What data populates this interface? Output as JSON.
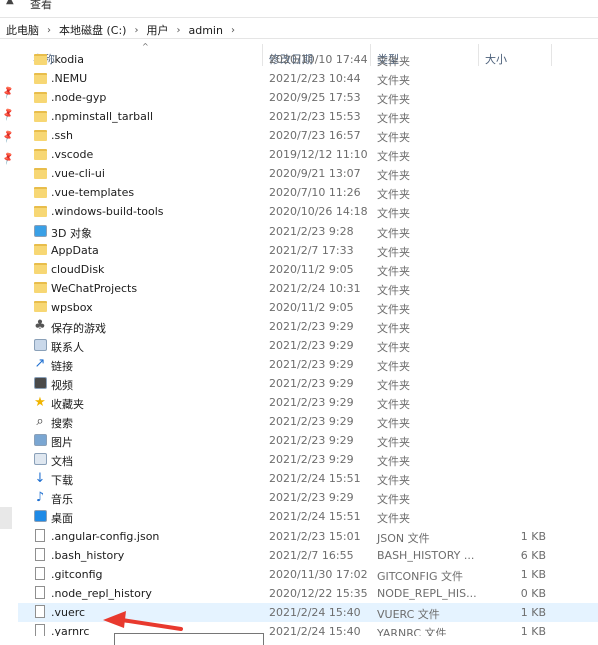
{
  "ribbon": {
    "view_tab": "查看"
  },
  "address": {
    "crumbs": [
      "此电脑",
      "本地磁盘 (C:)",
      "用户",
      "admin"
    ]
  },
  "columns": {
    "name": "名称",
    "date": "修改日期",
    "type": "类型",
    "size": "大小"
  },
  "colors": {
    "folder": "#f7d774",
    "selected_row": "#e5f3ff",
    "arrow": "#e8392e",
    "header_text": "#4c607a"
  },
  "rows": [
    {
      "name": ".kodia",
      "date": "2020/10/10 17:44",
      "type": "文件夹",
      "size": "",
      "icon": "folder-icon"
    },
    {
      "name": ".NEMU",
      "date": "2021/2/23 10:44",
      "type": "文件夹",
      "size": "",
      "icon": "folder-icon"
    },
    {
      "name": ".node-gyp",
      "date": "2020/9/25 17:53",
      "type": "文件夹",
      "size": "",
      "icon": "folder-icon"
    },
    {
      "name": ".npminstall_tarball",
      "date": "2021/2/23 15:53",
      "type": "文件夹",
      "size": "",
      "icon": "folder-icon"
    },
    {
      "name": ".ssh",
      "date": "2020/7/23 16:57",
      "type": "文件夹",
      "size": "",
      "icon": "folder-icon"
    },
    {
      "name": ".vscode",
      "date": "2019/12/12 11:10",
      "type": "文件夹",
      "size": "",
      "icon": "folder-icon"
    },
    {
      "name": ".vue-cli-ui",
      "date": "2020/9/21 13:07",
      "type": "文件夹",
      "size": "",
      "icon": "folder-icon"
    },
    {
      "name": ".vue-templates",
      "date": "2020/7/10 11:26",
      "type": "文件夹",
      "size": "",
      "icon": "folder-icon"
    },
    {
      "name": ".windows-build-tools",
      "date": "2020/10/26 14:18",
      "type": "文件夹",
      "size": "",
      "icon": "folder-icon"
    },
    {
      "name": "3D 对象",
      "date": "2021/2/23 9:28",
      "type": "文件夹",
      "size": "",
      "icon": "3d-objects-icon"
    },
    {
      "name": "AppData",
      "date": "2021/2/7 17:33",
      "type": "文件夹",
      "size": "",
      "icon": "folder-icon"
    },
    {
      "name": "cloudDisk",
      "date": "2020/11/2 9:05",
      "type": "文件夹",
      "size": "",
      "icon": "folder-icon"
    },
    {
      "name": "WeChatProjects",
      "date": "2021/2/24 10:31",
      "type": "文件夹",
      "size": "",
      "icon": "folder-icon"
    },
    {
      "name": "wpsbox",
      "date": "2020/11/2 9:05",
      "type": "文件夹",
      "size": "",
      "icon": "folder-icon"
    },
    {
      "name": "保存的游戏",
      "date": "2021/2/23 9:29",
      "type": "文件夹",
      "size": "",
      "icon": "saved-games-icon"
    },
    {
      "name": "联系人",
      "date": "2021/2/23 9:29",
      "type": "文件夹",
      "size": "",
      "icon": "contacts-icon"
    },
    {
      "name": "链接",
      "date": "2021/2/23 9:29",
      "type": "文件夹",
      "size": "",
      "icon": "links-icon"
    },
    {
      "name": "视频",
      "date": "2021/2/23 9:29",
      "type": "文件夹",
      "size": "",
      "icon": "videos-icon"
    },
    {
      "name": "收藏夹",
      "date": "2021/2/23 9:29",
      "type": "文件夹",
      "size": "",
      "icon": "favorites-icon"
    },
    {
      "name": "搜索",
      "date": "2021/2/23 9:29",
      "type": "文件夹",
      "size": "",
      "icon": "searches-icon"
    },
    {
      "name": "图片",
      "date": "2021/2/23 9:29",
      "type": "文件夹",
      "size": "",
      "icon": "pictures-icon"
    },
    {
      "name": "文档",
      "date": "2021/2/23 9:29",
      "type": "文件夹",
      "size": "",
      "icon": "documents-icon"
    },
    {
      "name": "下载",
      "date": "2021/2/24 15:51",
      "type": "文件夹",
      "size": "",
      "icon": "downloads-icon"
    },
    {
      "name": "音乐",
      "date": "2021/2/23 9:29",
      "type": "文件夹",
      "size": "",
      "icon": "music-icon"
    },
    {
      "name": "桌面",
      "date": "2021/2/24 15:51",
      "type": "文件夹",
      "size": "",
      "icon": "desktop-icon"
    },
    {
      "name": ".angular-config.json",
      "date": "2021/2/23 15:01",
      "type": "JSON 文件",
      "size": "1 KB",
      "icon": "file-icon"
    },
    {
      "name": ".bash_history",
      "date": "2021/2/7 16:55",
      "type": "BASH_HISTORY ...",
      "size": "6 KB",
      "icon": "file-icon"
    },
    {
      "name": ".gitconfig",
      "date": "2020/11/30 17:02",
      "type": "GITCONFIG 文件",
      "size": "1 KB",
      "icon": "file-icon"
    },
    {
      "name": ".node_repl_history",
      "date": "2020/12/22 15:35",
      "type": "NODE_REPL_HIS...",
      "size": "0 KB",
      "icon": "file-icon"
    },
    {
      "name": ".vuerc",
      "date": "2021/2/24 15:40",
      "type": "VUERC 文件",
      "size": "1 KB",
      "icon": "file-icon",
      "selected": true
    },
    {
      "name": ".yarnrc",
      "date": "2021/2/24 15:40",
      "type": "YARNRC 文件",
      "size": "1 KB",
      "icon": "file-icon"
    }
  ]
}
